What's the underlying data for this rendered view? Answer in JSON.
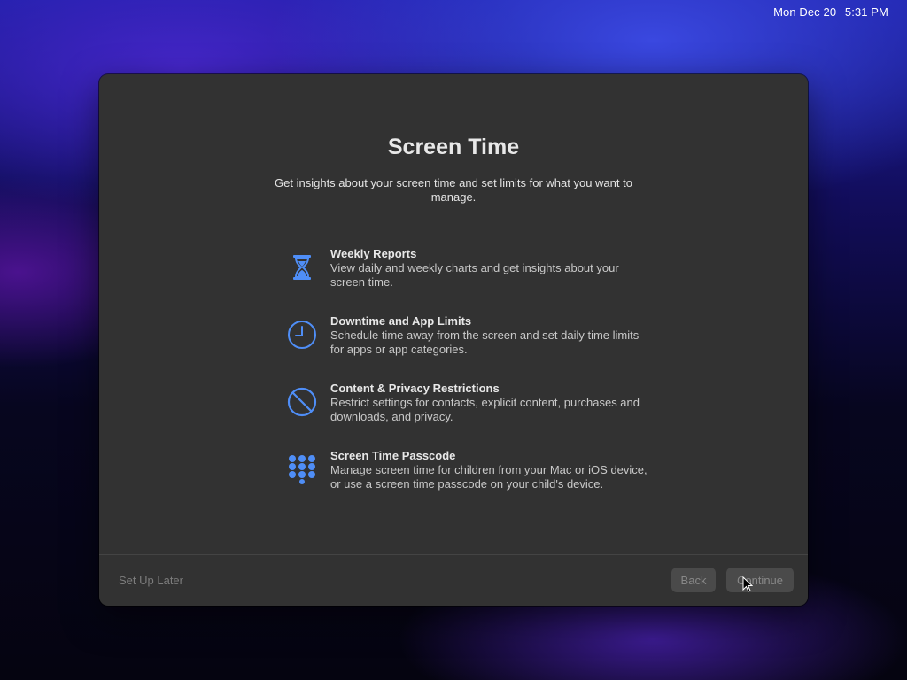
{
  "menubar": {
    "date": "Mon Dec 20",
    "time": "5:31 PM"
  },
  "dialog": {
    "title": "Screen Time",
    "subtitle": "Get insights about your screen time and set limits for what you want to manage.",
    "accent_color": "#4f8ef7",
    "features": [
      {
        "icon": "hourglass-icon",
        "title": "Weekly Reports",
        "description": "View daily and weekly charts and get insights about your screen time."
      },
      {
        "icon": "clock-icon",
        "title": "Downtime and App Limits",
        "description": "Schedule time away from the screen and set daily time limits for apps or app categories."
      },
      {
        "icon": "restriction-icon",
        "title": "Content & Privacy Restrictions",
        "description": "Restrict settings for contacts, explicit content, purchases and downloads, and privacy."
      },
      {
        "icon": "keypad-icon",
        "title": "Screen Time Passcode",
        "description": "Manage screen time for children from your Mac or iOS device, or use a screen time passcode on your child's device."
      }
    ]
  },
  "footer": {
    "setup_later_label": "Set Up Later",
    "back_label": "Back",
    "continue_label": "Continue"
  }
}
